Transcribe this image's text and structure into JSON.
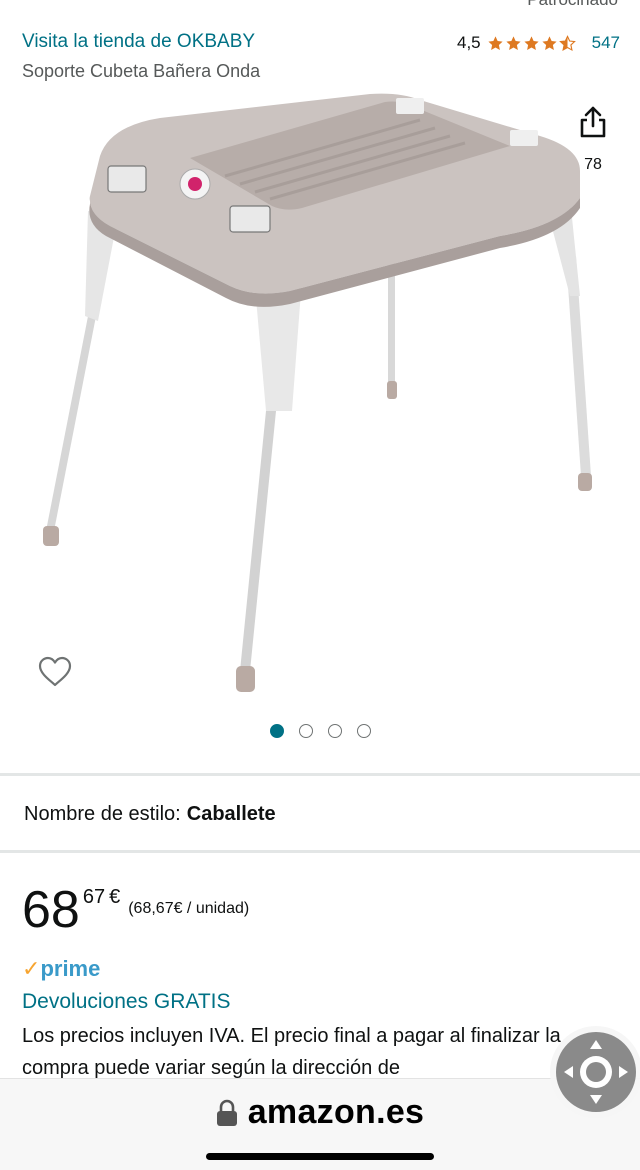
{
  "header": {
    "sponsored_label": "Patrocinado",
    "store_link": "Visita la tienda de OKBABY",
    "rating_value": "4,5",
    "rating_stars": 4.5,
    "rating_count": "547",
    "product_title": "Soporte Cubeta Bañera Onda"
  },
  "gallery": {
    "share_count": "78",
    "image_count": 4,
    "active_image": 1,
    "share_icon": "share-icon",
    "wishlist_icon": "heart-icon"
  },
  "style": {
    "label": "Nombre de estilo:",
    "value": "Caballete"
  },
  "price": {
    "whole": "68",
    "fraction": "67",
    "currency": "€",
    "unit_price": "(68,67€ / unidad)"
  },
  "delivery": {
    "prime_check": "✓",
    "prime_label": "prime",
    "free_returns": "Devoluciones GRATIS",
    "tax_note": "Los precios incluyen IVA. El precio final a pagar al finalizar la compra puede variar según la dirección de"
  },
  "browser": {
    "url": "amazon.es",
    "lock_icon": "lock-icon"
  },
  "colors": {
    "link": "#007185",
    "star": "#de7921",
    "prime": "#3a9ac9",
    "prime_check": "#f7a531"
  }
}
